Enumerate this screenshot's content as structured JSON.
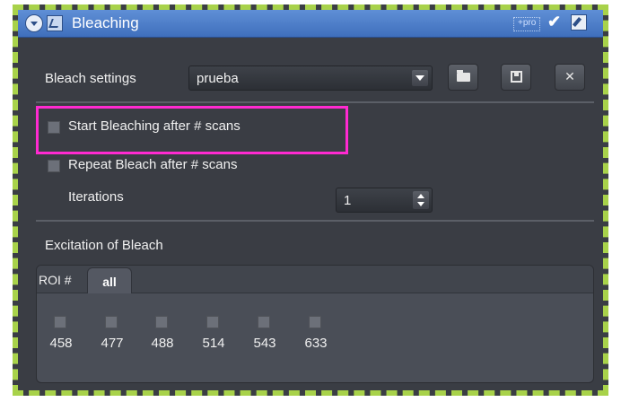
{
  "window": {
    "title": "Bleaching",
    "badge": "+pro"
  },
  "bleach_settings": {
    "label": "Bleach settings",
    "selected": "prueba"
  },
  "options": {
    "start_bleaching": {
      "label": "Start Bleaching after # scans",
      "checked": false
    },
    "repeat_bleach": {
      "label": "Repeat Bleach after # scans",
      "checked": false
    },
    "iterations_label": "Iterations",
    "iterations_value": "1"
  },
  "excitation": {
    "heading": "Excitation of Bleach",
    "roi_label": "ROI #",
    "tab_label": "all",
    "wavelengths": [
      "458",
      "477",
      "488",
      "514",
      "543",
      "633"
    ]
  },
  "colors": {
    "highlight": "#ff2ad1",
    "titlebar": "#4f7fca",
    "frame_dash": "#a8d24a"
  },
  "icons": {
    "collapse": "collapse-circle-icon",
    "window": "window-icon",
    "apply": "check-icon",
    "edit": "edit-icon",
    "open": "folder-open-icon",
    "save": "save-disk-icon",
    "delete": "close-icon"
  }
}
